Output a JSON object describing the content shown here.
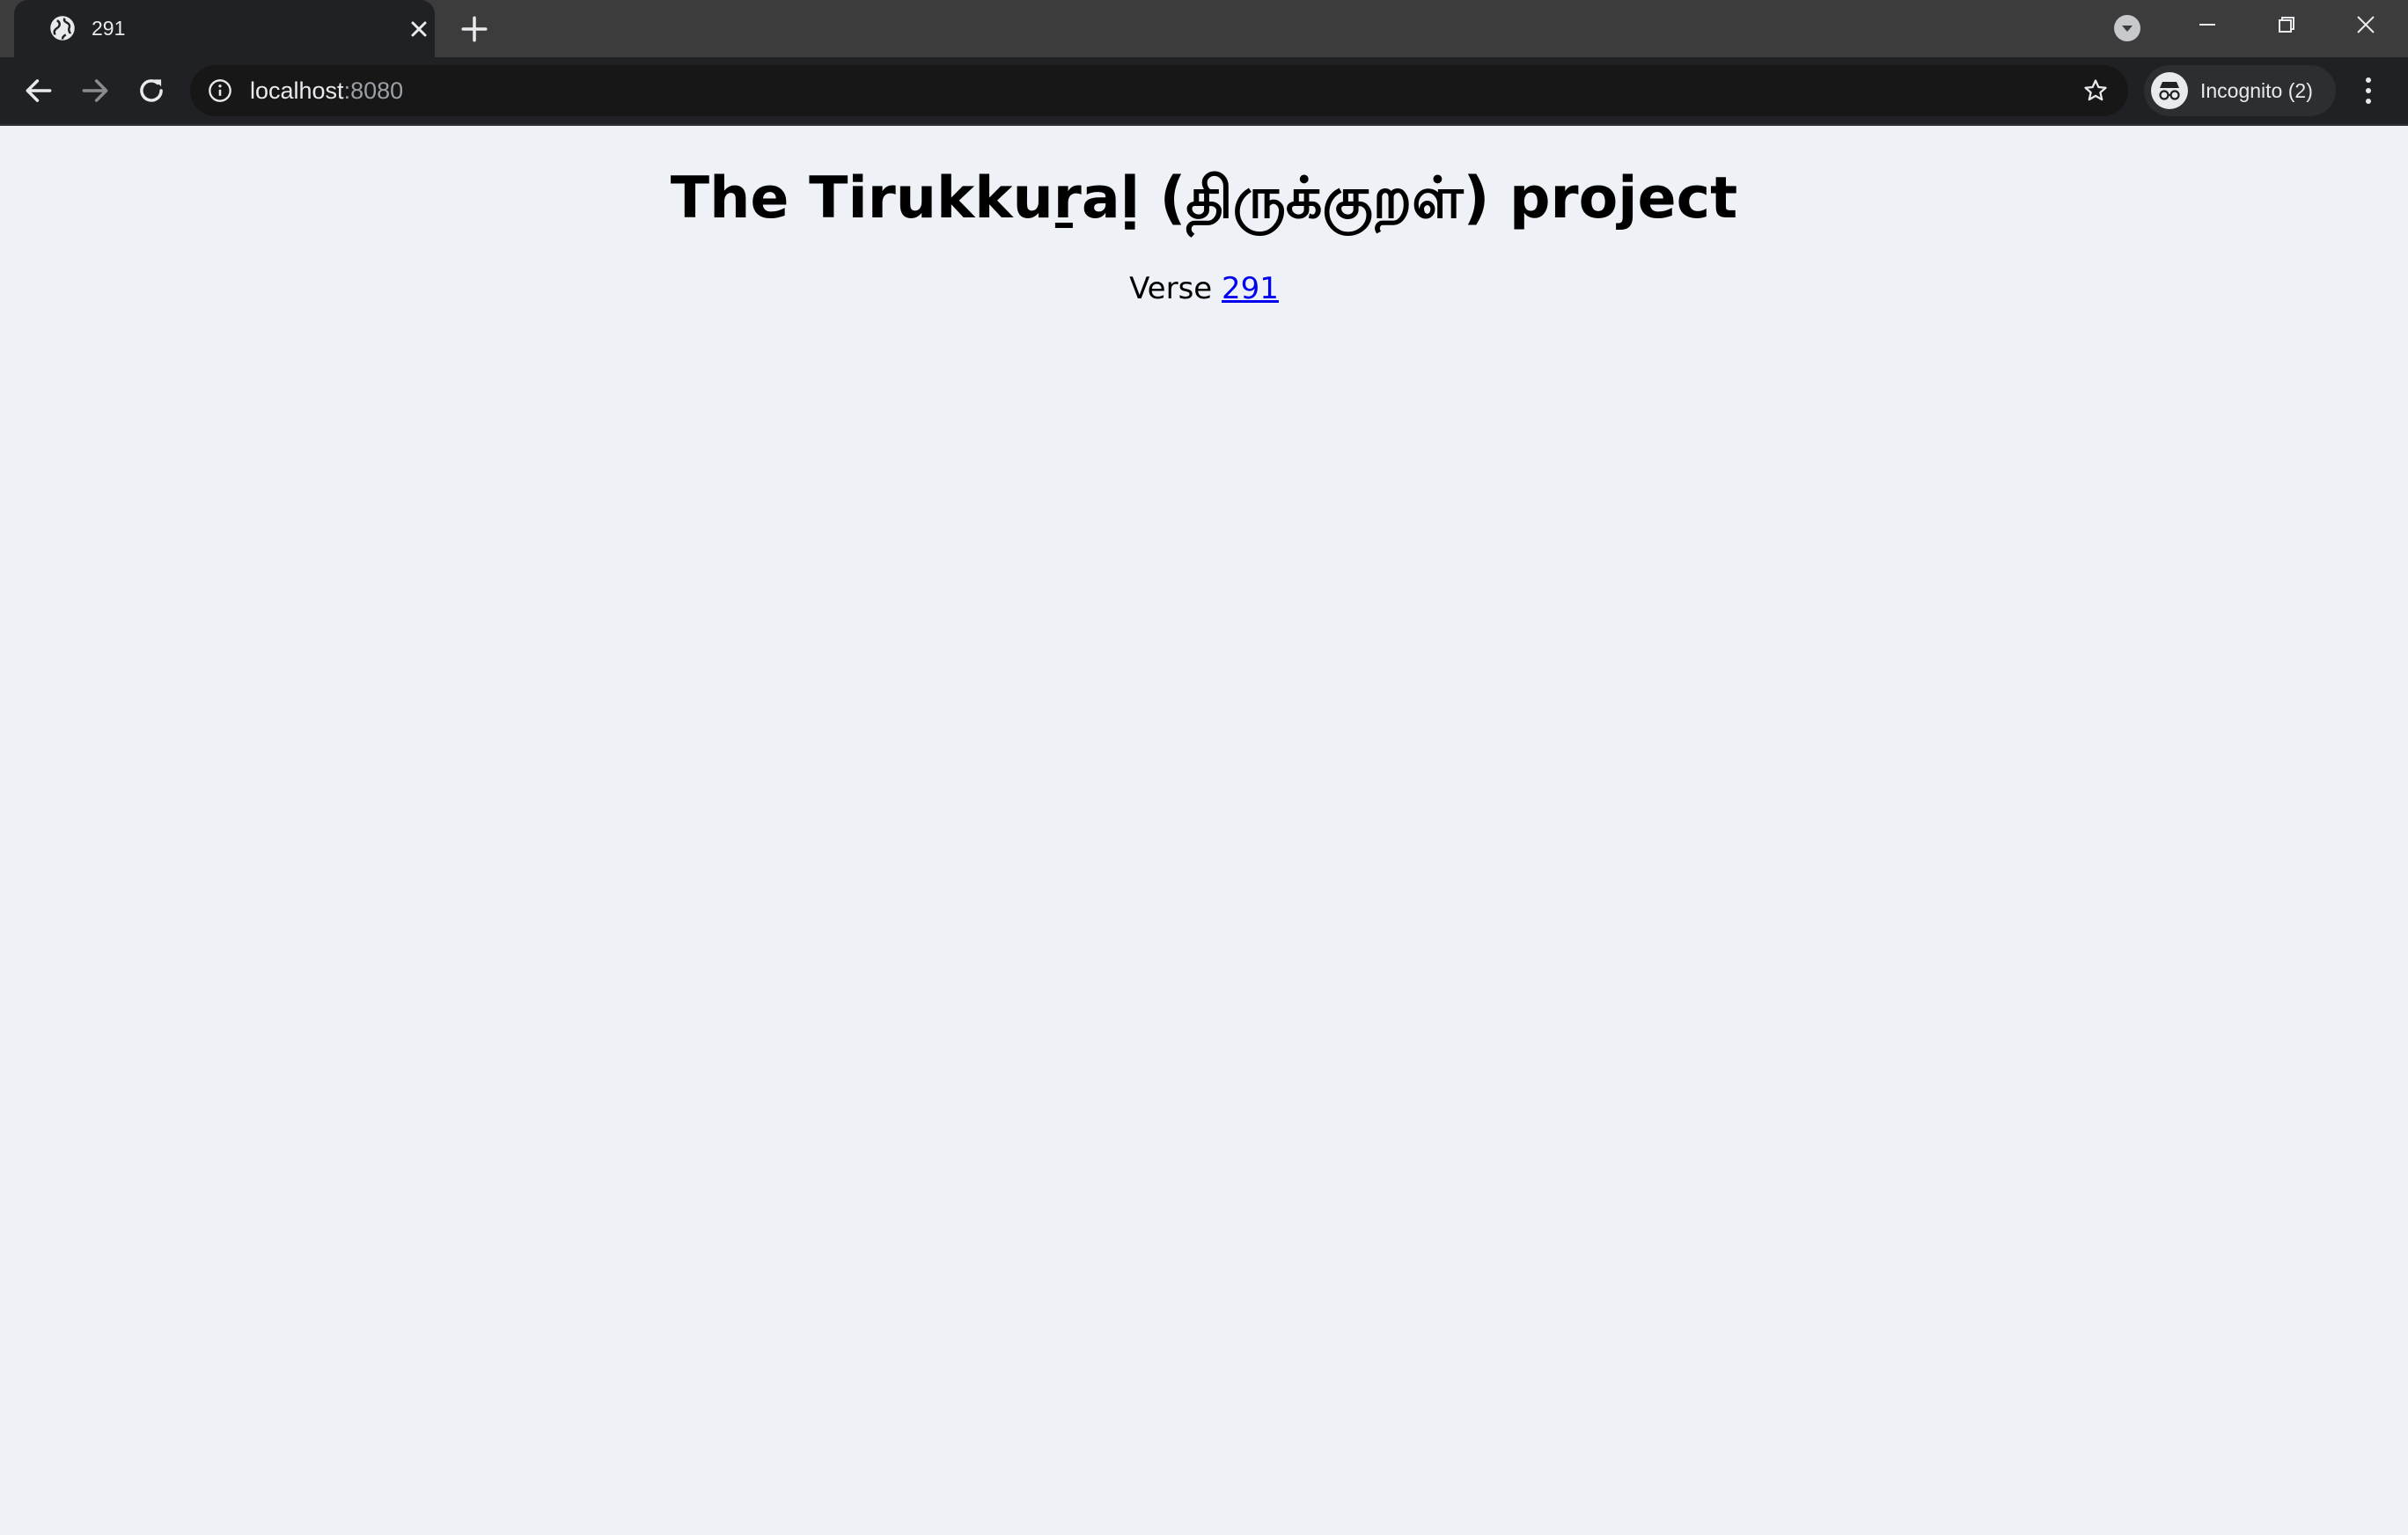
{
  "browser": {
    "tab": {
      "title": "291",
      "favicon": "globe-icon"
    },
    "address_bar": {
      "host": "localhost",
      "port": ":8080"
    },
    "profile": {
      "label": "Incognito (2)",
      "icon": "incognito-icon"
    }
  },
  "page": {
    "title": "The Tirukkuṟaḷ (திருக்குறள்) project",
    "verse_label": "Verse",
    "verse_number": "291"
  },
  "colors": {
    "page_background": "#eef1f6",
    "link": "#0000ee",
    "chrome_dark": "#202124"
  }
}
